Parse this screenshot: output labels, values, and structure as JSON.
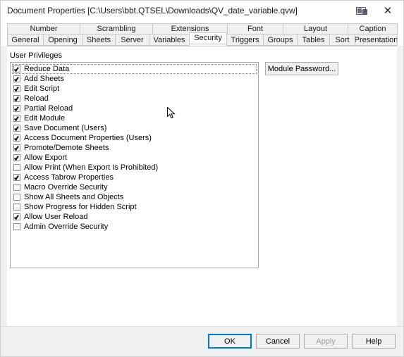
{
  "window": {
    "title": "Document Properties [C:\\Users\\bbt.QTSEL\\Downloads\\QV_date_variable.qvw]",
    "context_help_icon": "context-help-icon",
    "close_icon": "close-icon"
  },
  "tabs": {
    "row1": [
      {
        "label": "Number",
        "active": false
      },
      {
        "label": "Scrambling",
        "active": false
      },
      {
        "label": "Extensions",
        "active": false
      },
      {
        "label": "Font",
        "active": false
      },
      {
        "label": "Layout",
        "active": false
      },
      {
        "label": "Caption",
        "active": false
      }
    ],
    "row2": [
      {
        "label": "General",
        "active": false
      },
      {
        "label": "Opening",
        "active": false
      },
      {
        "label": "Sheets",
        "active": false
      },
      {
        "label": "Server",
        "active": false
      },
      {
        "label": "Variables",
        "active": false
      },
      {
        "label": "Security",
        "active": true
      },
      {
        "label": "Triggers",
        "active": false
      },
      {
        "label": "Groups",
        "active": false
      },
      {
        "label": "Tables",
        "active": false
      },
      {
        "label": "Sort",
        "active": false
      },
      {
        "label": "Presentation",
        "active": false
      }
    ]
  },
  "security_page": {
    "group_label": "User Privileges",
    "privileges": [
      {
        "label": "Reduce Data",
        "checked": true,
        "focused": true
      },
      {
        "label": "Add Sheets",
        "checked": true,
        "focused": false
      },
      {
        "label": "Edit Script",
        "checked": true,
        "focused": false
      },
      {
        "label": "Reload",
        "checked": true,
        "focused": false
      },
      {
        "label": "Partial Reload",
        "checked": true,
        "focused": false
      },
      {
        "label": "Edit Module",
        "checked": true,
        "focused": false
      },
      {
        "label": "Save Document (Users)",
        "checked": true,
        "focused": false
      },
      {
        "label": "Access Document Properties (Users)",
        "checked": true,
        "focused": false
      },
      {
        "label": "Promote/Demote Sheets",
        "checked": true,
        "focused": false
      },
      {
        "label": "Allow Export",
        "checked": true,
        "focused": false
      },
      {
        "label": "Allow Print (When Export Is Prohibited)",
        "checked": false,
        "focused": false
      },
      {
        "label": "Access Tabrow Properties",
        "checked": true,
        "focused": false
      },
      {
        "label": "Macro Override Security",
        "checked": false,
        "focused": false
      },
      {
        "label": "Show All Sheets and Objects",
        "checked": false,
        "focused": false
      },
      {
        "label": "Show Progress for Hidden Script",
        "checked": false,
        "focused": false
      },
      {
        "label": "Allow User Reload",
        "checked": true,
        "focused": false
      },
      {
        "label": "Admin Override Security",
        "checked": false,
        "focused": false
      }
    ],
    "module_password_label": "Module Password..."
  },
  "footer": {
    "ok_label": "OK",
    "cancel_label": "Cancel",
    "apply_label": "Apply",
    "help_label": "Help",
    "apply_enabled": false,
    "ok_is_default": true
  },
  "colors": {
    "focus_blue": "#0078d7",
    "window_bg": "#f0f0f0",
    "page_bg": "#ffffff",
    "border": "#c8c8c8",
    "disabled_text": "#a0a0a0"
  }
}
